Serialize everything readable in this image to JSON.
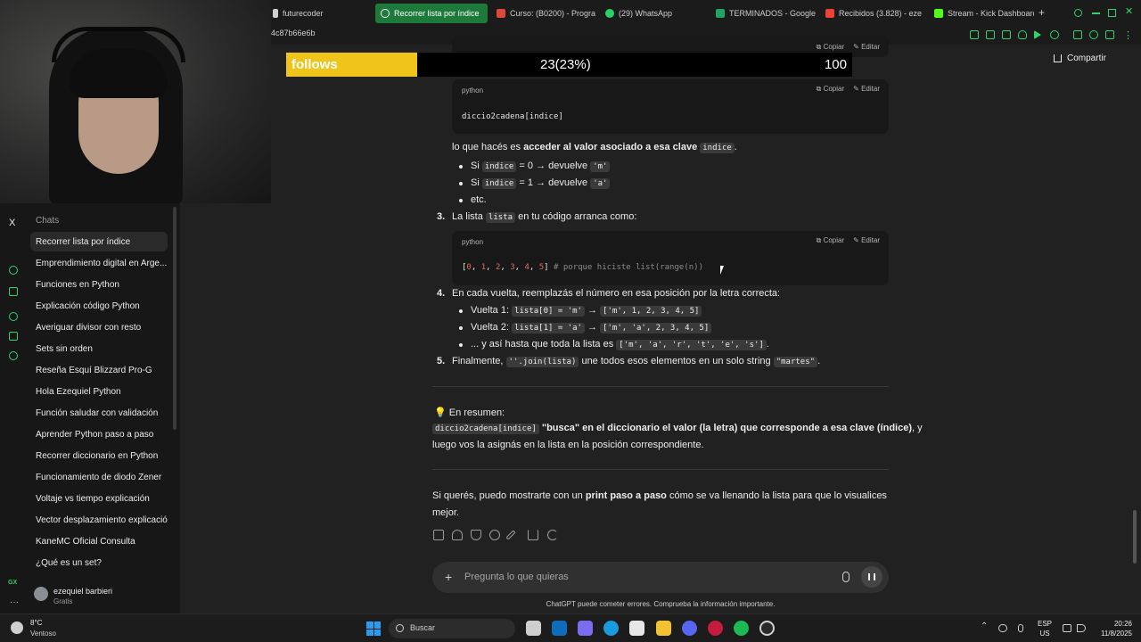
{
  "browser": {
    "tabs": [
      {
        "label": "futurecoder",
        "icon": "futurecoder-icon",
        "color": "#cfcfcf"
      },
      {
        "label": "Recorrer lista por índice",
        "icon": "chatgpt-icon",
        "color": "#ffffff"
      },
      {
        "label": "Curso: (B0200) - Progra",
        "icon": "course-icon",
        "color": "#e0473a"
      },
      {
        "label": "(29) WhatsApp",
        "icon": "whatsapp-icon",
        "color": "#25d366"
      },
      {
        "label": "TERMINADOS - Google",
        "icon": "sheets-icon",
        "color": "#1fa463"
      },
      {
        "label": "Recibidos (3.828) - eze",
        "icon": "gmail-icon",
        "color": "#ea4335"
      },
      {
        "label": "Stream - Kick Dashboard",
        "icon": "kick-icon",
        "color": "#53fc18"
      }
    ],
    "url_fragment": "4c87b66e6b"
  },
  "sidebar": {
    "title": "Chats",
    "items": [
      "Recorrer lista por índice",
      "Emprendimiento digital en Arge...",
      "Funciones en Python",
      "Explicación código Python",
      "Averiguar divisor con resto",
      "Sets sin orden",
      "Reseña Esquí Blizzard Pro-G",
      "Hola Ezequiel Python",
      "Función saludar con validación",
      "Aprender Python paso a paso",
      "Recorrer diccionario en Python",
      "Funcionamiento de diodo Zener",
      "Voltaje vs tiempo explicación",
      "Vector desplazamiento explicación",
      "KaneMC Oficial Consulta",
      "¿Qué es un set?"
    ],
    "user_name": "ezequiel barbieri",
    "user_plan": "Gratis"
  },
  "header": {
    "share_label": "Compartir"
  },
  "overlay": {
    "label": "follows",
    "count": "23(23%)",
    "goal": "100"
  },
  "code_actions": {
    "copy": "Copiar",
    "edit": "Editar"
  },
  "content": {
    "code1": {
      "lang": "python",
      "code": "diccio2cadena[indice]"
    },
    "p1_pre": "lo que hacés es ",
    "p1_bold": "acceder al valor asociado a esa clave",
    "p1_code": "indice",
    "p1_post": ".",
    "b1_pre": "Si ",
    "b1_code": "indice",
    "b1_mid": " = 0 → devuelve ",
    "b1_val": "'m'",
    "b2_pre": "Si ",
    "b2_code": "indice",
    "b2_mid": " = 1 → devuelve ",
    "b2_val": "'a'",
    "b3": "etc.",
    "n3": "3.",
    "s3_pre": "La lista ",
    "s3_code": "lista",
    "s3_post": " en tu código arranca como:",
    "code2": {
      "lang": "python",
      "comment": "# porque hiciste list(range(n))"
    },
    "n4": "4.",
    "s4": "En cada vuelta, reemplazás el número en esa posición por la letra correcta:",
    "v1_pre": "Vuelta 1: ",
    "v1_code": "lista[0] = 'm'",
    "v1_res": "['m', 1, 2, 3, 4, 5]",
    "v2_pre": "Vuelta 2: ",
    "v2_code": "lista[1] = 'a'",
    "v2_res": "['m', 'a', 2, 3, 4, 5]",
    "v3_pre": "... y así hasta que toda la lista es ",
    "v3_code": "['m', 'a', 'r', 't', 'e', 's']",
    "v3_post": ".",
    "n5": "5.",
    "s5_pre": "Finalmente, ",
    "s5_code": "''.join(lista)",
    "s5_mid": " une todos esos elementos en un solo string ",
    "s5_val": "\"martes\"",
    "s5_post": ".",
    "summary_title": "💡 En resumen:",
    "summary_code": "diccio2cadena[indice]",
    "summary_bold": " \"busca\" en el diccionario el valor (la letra) que corresponde a esa clave (índice)",
    "summary_post": ", y",
    "summary_line2": "luego vos la asignás en la lista en la posición correspondiente.",
    "offer_pre": "Si querés, puedo mostrarte con un ",
    "offer_bold": "print paso a paso",
    "offer_post": " cómo se va llenando la lista para que lo visualices",
    "offer_line2": "mejor."
  },
  "composer": {
    "placeholder": "Pregunta lo que quieras"
  },
  "disclaimer": "ChatGPT puede cometer errores. Comprueba la información importante.",
  "taskbar": {
    "weather_temp": "8°C",
    "weather_desc": "Ventoso",
    "search_label": "Buscar",
    "lang_top": "ESP",
    "lang_bottom": "US",
    "time": "20:26",
    "date": "11/8/2025"
  }
}
